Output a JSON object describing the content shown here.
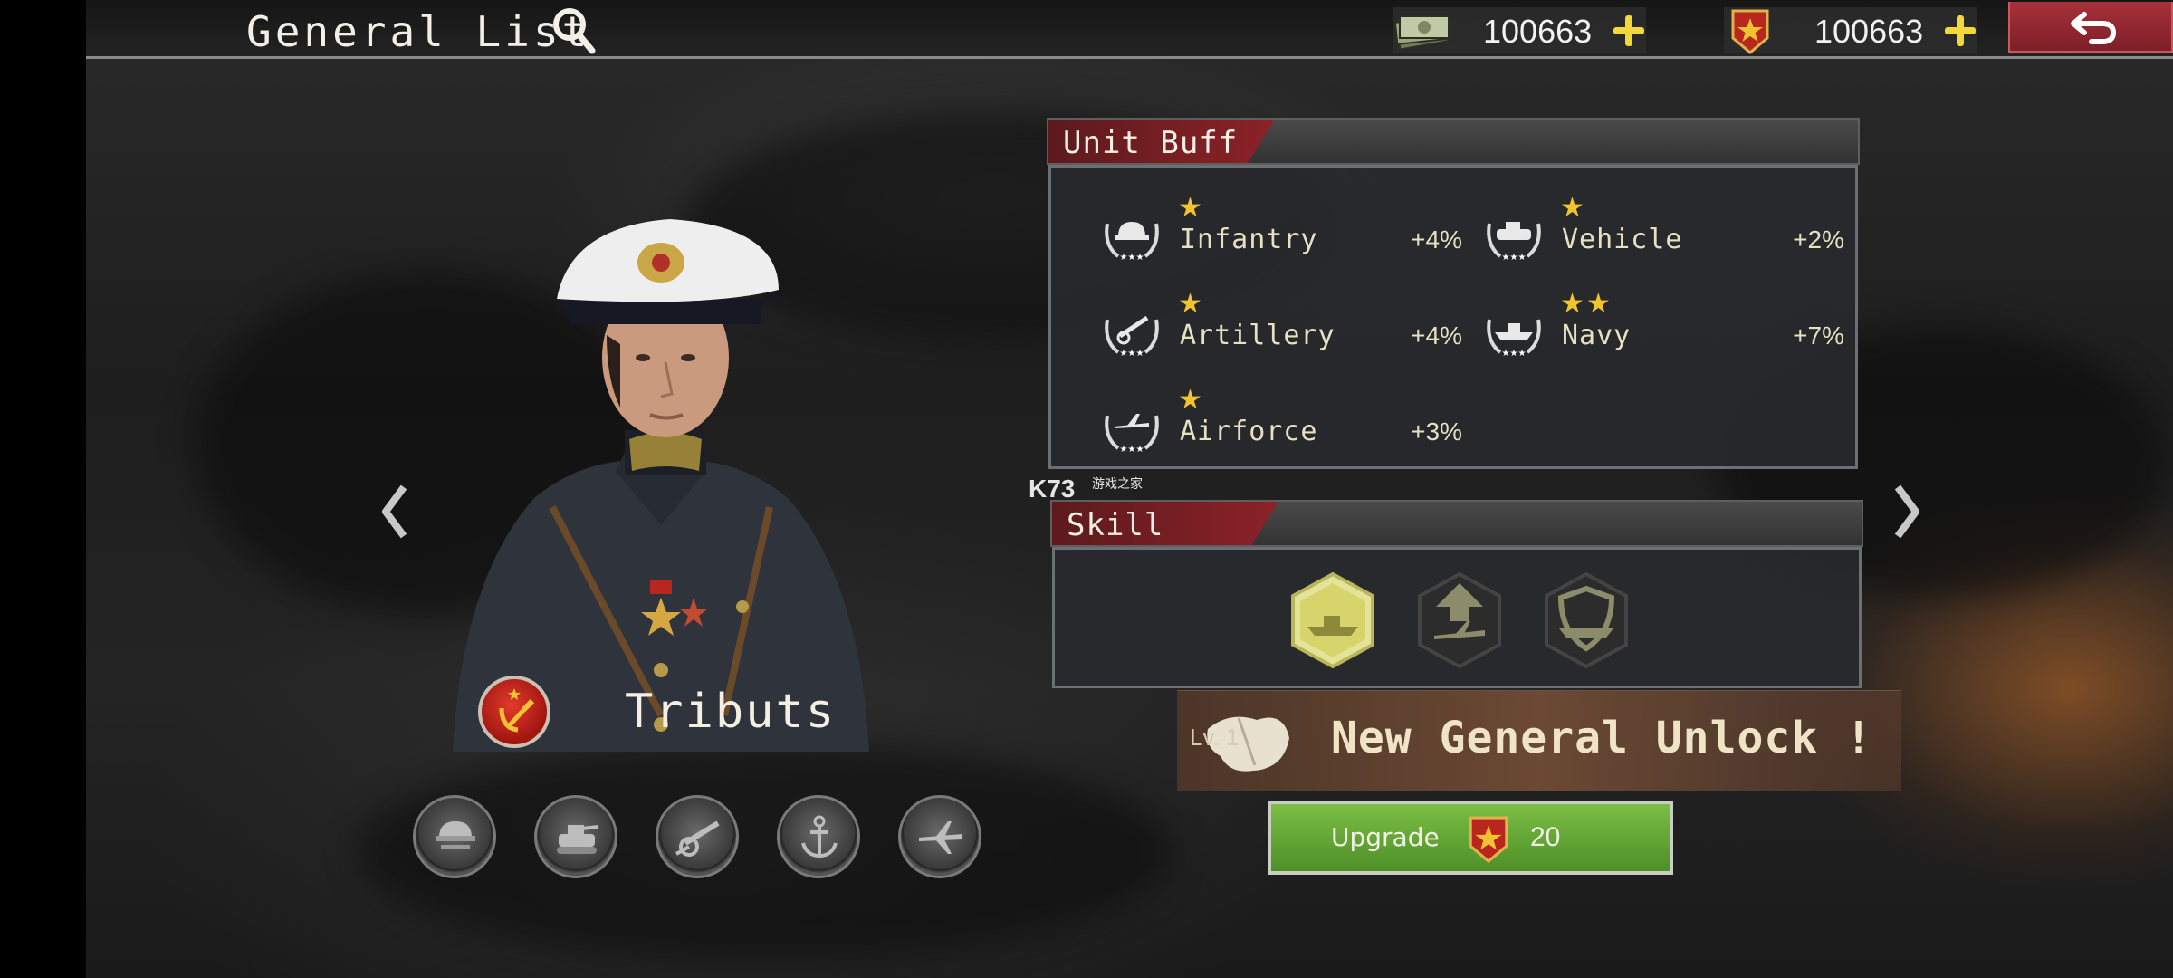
{
  "header": {
    "title": "General List",
    "cash": {
      "value": "100663",
      "icon": "cash-icon"
    },
    "medals": {
      "value": "100663",
      "icon": "star-badge-icon"
    },
    "back_icon": "back-arrow-icon"
  },
  "general": {
    "name": "Tributs",
    "faction_icon": "hammer-sickle-icon",
    "unit_medals": [
      "infantry-medal-icon",
      "vehicle-medal-icon",
      "artillery-medal-icon",
      "navy-medal-icon",
      "airforce-medal-icon"
    ]
  },
  "unit_buff": {
    "title": "Unit Buff",
    "items": [
      {
        "name": "Infantry",
        "stars": "★",
        "value": "+4%"
      },
      {
        "name": "Vehicle",
        "stars": "★",
        "value": "+2%"
      },
      {
        "name": "Artillery",
        "stars": "★",
        "value": "+4%"
      },
      {
        "name": "Navy",
        "stars": "★★",
        "value": "+7%"
      },
      {
        "name": "Airforce",
        "stars": "★",
        "value": "+3%"
      }
    ]
  },
  "skill": {
    "title": "Skill",
    "icons": [
      "naval-bombard-skill-icon",
      "air-strike-skill-icon",
      "naval-shield-skill-icon"
    ]
  },
  "watermark": {
    "text": "K73",
    "sub": "游戏之家"
  },
  "unlock": {
    "level": "Lv. 1",
    "text": "New General Unlock !"
  },
  "upgrade": {
    "label": "Upgrade",
    "cost": "20"
  },
  "colors": {
    "accent_red": "#8c2228",
    "upgrade_green": "#5e9f32",
    "star_gold": "#f1c232"
  }
}
